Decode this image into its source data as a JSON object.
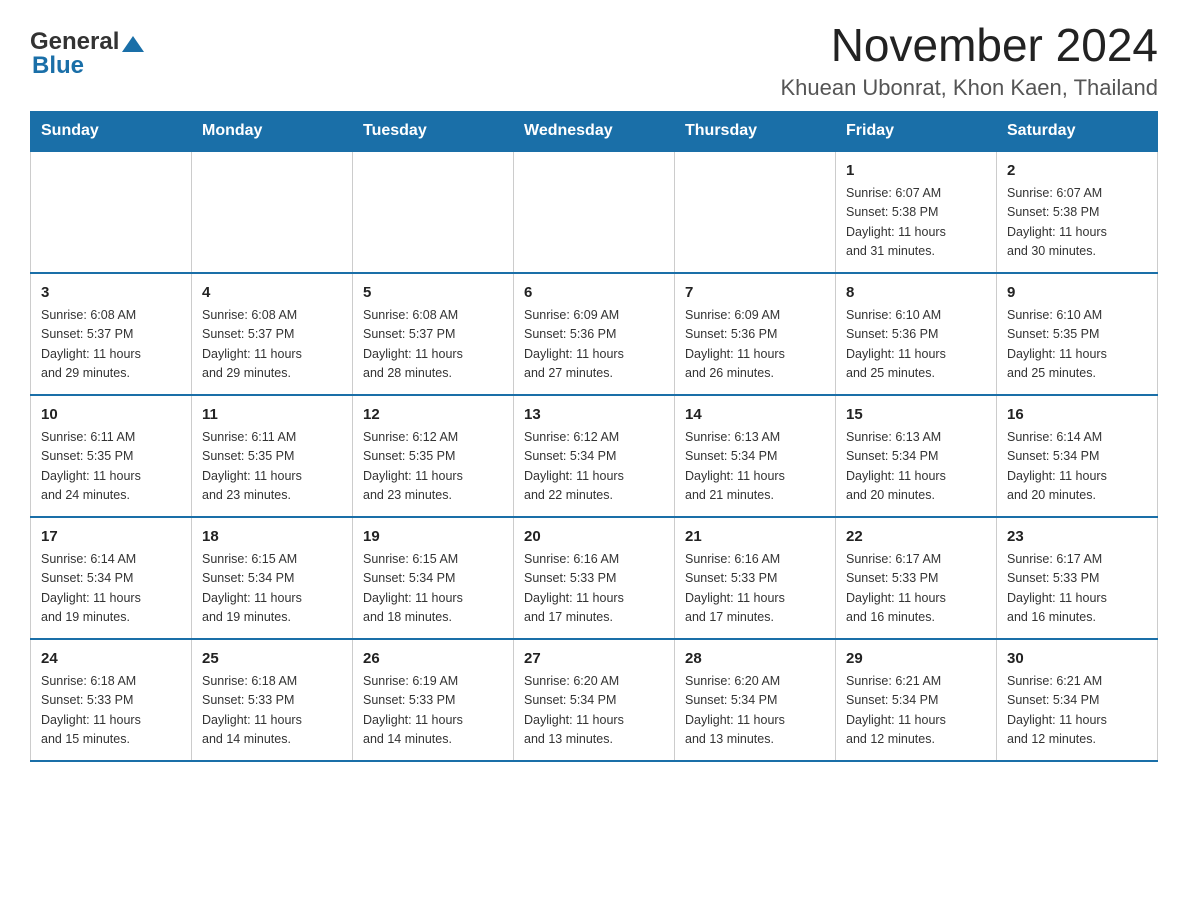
{
  "header": {
    "logo_general": "General",
    "logo_blue": "Blue",
    "month_title": "November 2024",
    "location": "Khuean Ubonrat, Khon Kaen, Thailand"
  },
  "days_of_week": [
    "Sunday",
    "Monday",
    "Tuesday",
    "Wednesday",
    "Thursday",
    "Friday",
    "Saturday"
  ],
  "weeks": [
    {
      "days": [
        {
          "number": "",
          "info": ""
        },
        {
          "number": "",
          "info": ""
        },
        {
          "number": "",
          "info": ""
        },
        {
          "number": "",
          "info": ""
        },
        {
          "number": "",
          "info": ""
        },
        {
          "number": "1",
          "info": "Sunrise: 6:07 AM\nSunset: 5:38 PM\nDaylight: 11 hours\nand 31 minutes."
        },
        {
          "number": "2",
          "info": "Sunrise: 6:07 AM\nSunset: 5:38 PM\nDaylight: 11 hours\nand 30 minutes."
        }
      ]
    },
    {
      "days": [
        {
          "number": "3",
          "info": "Sunrise: 6:08 AM\nSunset: 5:37 PM\nDaylight: 11 hours\nand 29 minutes."
        },
        {
          "number": "4",
          "info": "Sunrise: 6:08 AM\nSunset: 5:37 PM\nDaylight: 11 hours\nand 29 minutes."
        },
        {
          "number": "5",
          "info": "Sunrise: 6:08 AM\nSunset: 5:37 PM\nDaylight: 11 hours\nand 28 minutes."
        },
        {
          "number": "6",
          "info": "Sunrise: 6:09 AM\nSunset: 5:36 PM\nDaylight: 11 hours\nand 27 minutes."
        },
        {
          "number": "7",
          "info": "Sunrise: 6:09 AM\nSunset: 5:36 PM\nDaylight: 11 hours\nand 26 minutes."
        },
        {
          "number": "8",
          "info": "Sunrise: 6:10 AM\nSunset: 5:36 PM\nDaylight: 11 hours\nand 25 minutes."
        },
        {
          "number": "9",
          "info": "Sunrise: 6:10 AM\nSunset: 5:35 PM\nDaylight: 11 hours\nand 25 minutes."
        }
      ]
    },
    {
      "days": [
        {
          "number": "10",
          "info": "Sunrise: 6:11 AM\nSunset: 5:35 PM\nDaylight: 11 hours\nand 24 minutes."
        },
        {
          "number": "11",
          "info": "Sunrise: 6:11 AM\nSunset: 5:35 PM\nDaylight: 11 hours\nand 23 minutes."
        },
        {
          "number": "12",
          "info": "Sunrise: 6:12 AM\nSunset: 5:35 PM\nDaylight: 11 hours\nand 23 minutes."
        },
        {
          "number": "13",
          "info": "Sunrise: 6:12 AM\nSunset: 5:34 PM\nDaylight: 11 hours\nand 22 minutes."
        },
        {
          "number": "14",
          "info": "Sunrise: 6:13 AM\nSunset: 5:34 PM\nDaylight: 11 hours\nand 21 minutes."
        },
        {
          "number": "15",
          "info": "Sunrise: 6:13 AM\nSunset: 5:34 PM\nDaylight: 11 hours\nand 20 minutes."
        },
        {
          "number": "16",
          "info": "Sunrise: 6:14 AM\nSunset: 5:34 PM\nDaylight: 11 hours\nand 20 minutes."
        }
      ]
    },
    {
      "days": [
        {
          "number": "17",
          "info": "Sunrise: 6:14 AM\nSunset: 5:34 PM\nDaylight: 11 hours\nand 19 minutes."
        },
        {
          "number": "18",
          "info": "Sunrise: 6:15 AM\nSunset: 5:34 PM\nDaylight: 11 hours\nand 19 minutes."
        },
        {
          "number": "19",
          "info": "Sunrise: 6:15 AM\nSunset: 5:34 PM\nDaylight: 11 hours\nand 18 minutes."
        },
        {
          "number": "20",
          "info": "Sunrise: 6:16 AM\nSunset: 5:33 PM\nDaylight: 11 hours\nand 17 minutes."
        },
        {
          "number": "21",
          "info": "Sunrise: 6:16 AM\nSunset: 5:33 PM\nDaylight: 11 hours\nand 17 minutes."
        },
        {
          "number": "22",
          "info": "Sunrise: 6:17 AM\nSunset: 5:33 PM\nDaylight: 11 hours\nand 16 minutes."
        },
        {
          "number": "23",
          "info": "Sunrise: 6:17 AM\nSunset: 5:33 PM\nDaylight: 11 hours\nand 16 minutes."
        }
      ]
    },
    {
      "days": [
        {
          "number": "24",
          "info": "Sunrise: 6:18 AM\nSunset: 5:33 PM\nDaylight: 11 hours\nand 15 minutes."
        },
        {
          "number": "25",
          "info": "Sunrise: 6:18 AM\nSunset: 5:33 PM\nDaylight: 11 hours\nand 14 minutes."
        },
        {
          "number": "26",
          "info": "Sunrise: 6:19 AM\nSunset: 5:33 PM\nDaylight: 11 hours\nand 14 minutes."
        },
        {
          "number": "27",
          "info": "Sunrise: 6:20 AM\nSunset: 5:34 PM\nDaylight: 11 hours\nand 13 minutes."
        },
        {
          "number": "28",
          "info": "Sunrise: 6:20 AM\nSunset: 5:34 PM\nDaylight: 11 hours\nand 13 minutes."
        },
        {
          "number": "29",
          "info": "Sunrise: 6:21 AM\nSunset: 5:34 PM\nDaylight: 11 hours\nand 12 minutes."
        },
        {
          "number": "30",
          "info": "Sunrise: 6:21 AM\nSunset: 5:34 PM\nDaylight: 11 hours\nand 12 minutes."
        }
      ]
    }
  ]
}
